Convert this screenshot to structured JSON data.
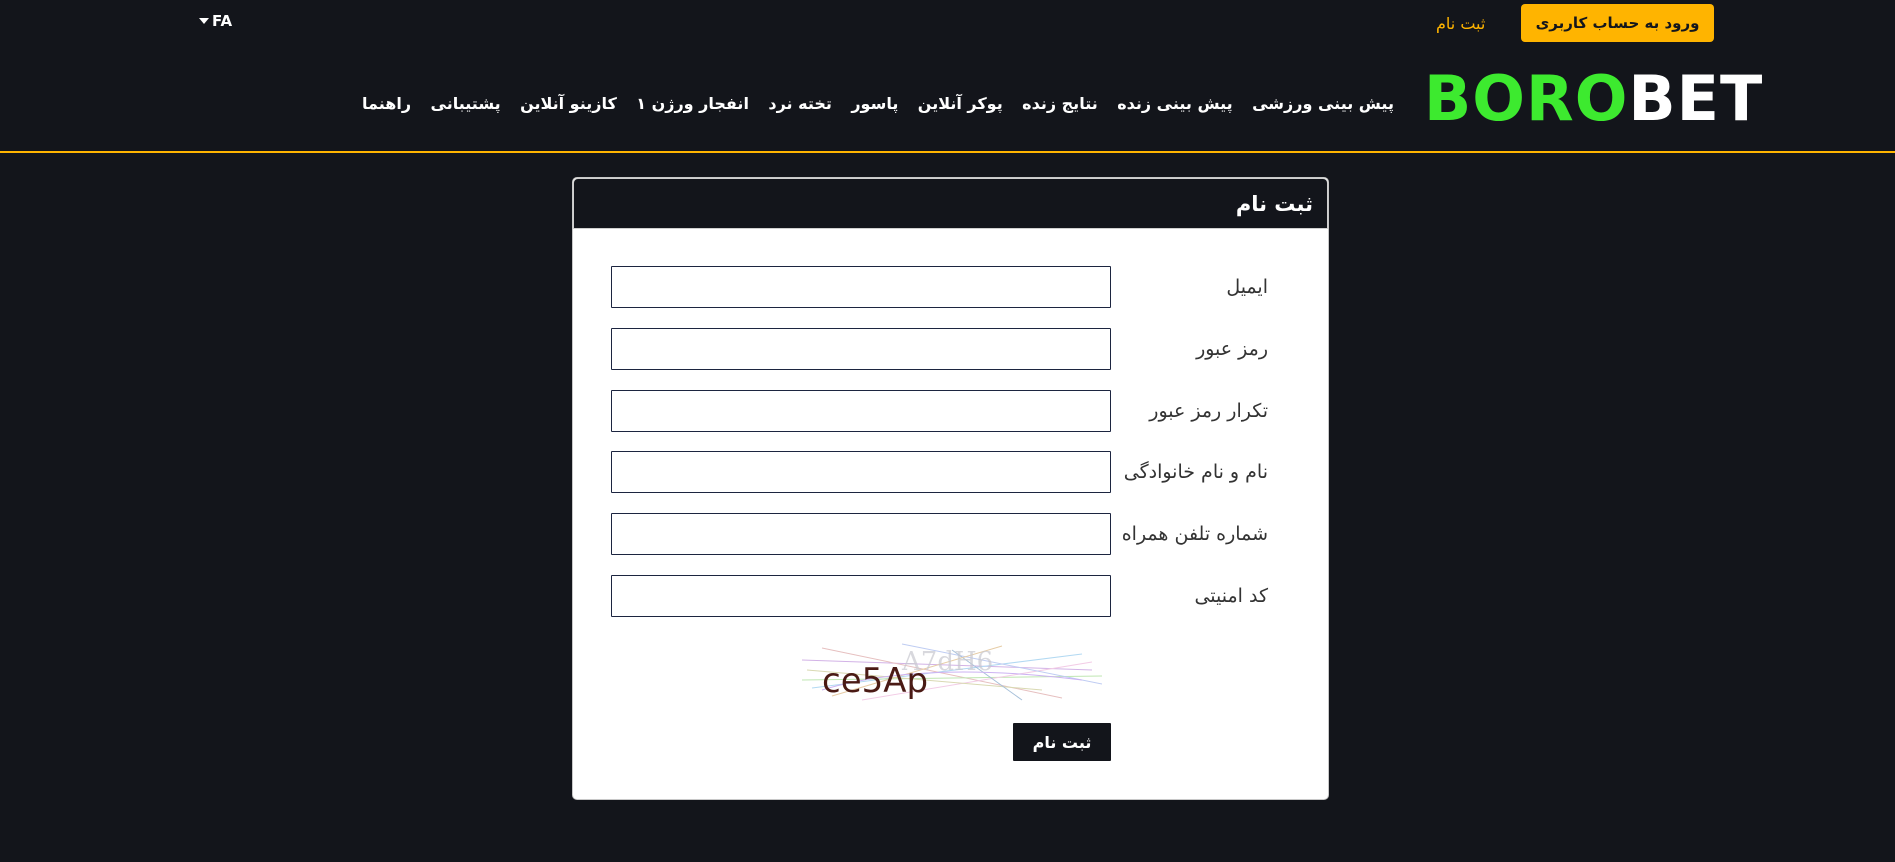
{
  "topbar": {
    "login_label": "ورود به حساب کاربری",
    "register_label": "ثبت نام",
    "language": "FA"
  },
  "logo": {
    "part1": "BORO",
    "part2": "BET"
  },
  "nav": {
    "items": [
      "پیش بینی ورزشی",
      "پیش بینی زنده",
      "نتایج زنده",
      "پوکر آنلاین",
      "پاسور",
      "تخته نرد",
      "انفجار ورژن ۱",
      "کازینو آنلاین",
      "پشتیبانی",
      "راهنما"
    ]
  },
  "form": {
    "title": "ثبت نام",
    "fields": [
      {
        "label": "ایمیل",
        "value": ""
      },
      {
        "label": "رمز عبور",
        "value": ""
      },
      {
        "label": "تکرار رمز عبور",
        "value": ""
      },
      {
        "label": "نام و نام خانوادگی",
        "value": ""
      },
      {
        "label": "شماره تلفن همراه",
        "value": ""
      },
      {
        "label": "کد امنیتی",
        "value": ""
      }
    ],
    "captcha_text": "ce5Ap",
    "submit_label": "ثبت نام"
  },
  "colors": {
    "accent": "#ffb400",
    "logo_green": "#3dea2f",
    "background": "#13151b"
  }
}
